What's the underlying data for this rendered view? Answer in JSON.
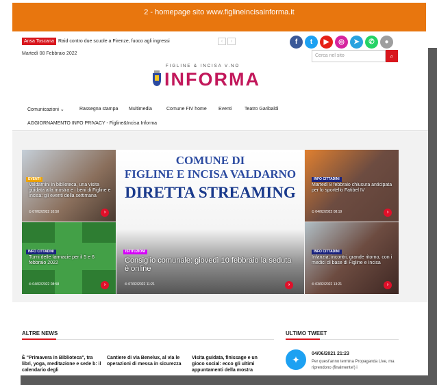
{
  "banner": {
    "caption": "2 - homepage sito www.figlineincisainforma.it"
  },
  "topbar": {
    "ticker_tag": "Ansa Toscana",
    "ticker_text": "Raid contro due scuole a Firenze, fuoco agli ingressi",
    "date": "Martedì 08 Febbraio 2022",
    "search_placeholder": "Cerca nel sito",
    "social": [
      {
        "name": "facebook-icon",
        "glyph": "f",
        "color": "#3b5998"
      },
      {
        "name": "twitter-icon",
        "glyph": "t",
        "color": "#1da1f2"
      },
      {
        "name": "youtube-icon",
        "glyph": "▶",
        "color": "#e62117"
      },
      {
        "name": "instagram-icon",
        "glyph": "◎",
        "color": "#d6249f"
      },
      {
        "name": "telegram-icon",
        "glyph": "➤",
        "color": "#2aa3df"
      },
      {
        "name": "whatsapp-icon",
        "glyph": "✆",
        "color": "#25d366"
      },
      {
        "name": "app-icon",
        "glyph": "●",
        "color": "#9e9e9e"
      }
    ]
  },
  "logo": {
    "top": "FIGLINE & INCISA V.NO",
    "main": "INFORMA",
    "color": "#c2185b"
  },
  "nav": {
    "items": [
      "Comunicazioni ⌄",
      "Rassegna stampa",
      "Multimedia",
      "Comune FIV home",
      "Eventi",
      "Teatro Garibaldi"
    ],
    "privacy": "AGGIORNAMENTO INFO PRIVACY - Figline&Incisa Informa"
  },
  "hero": {
    "line1": "COMUNE DI",
    "line2": "FIGLINE E INCISA VALDARNO",
    "line3": "DIRETTA STREAMING",
    "category": "ISTITUZIONI",
    "title": "Consiglio comunale: giovedì 10 febbraio la seduta è online",
    "date": "⏲ 07/02/2022 11:21"
  },
  "tiles": [
    {
      "category": "EVENTI",
      "cat_color": "#f0a500",
      "title": "Valdarnini in biblioteca, una visita guidata alla mostra e i beni di Figline e Incisa: gli eventi della settimana",
      "date": "⏲ 07/02/2022 10:50"
    },
    {
      "category": "INFO CITTADINI",
      "cat_color": "#1a237e",
      "title": "Martedì 8 febbraio chiusura anticipata per lo sportello Fatibel IV",
      "date": "⏲ 04/02/2022 08:19"
    },
    {
      "category": "INFO CITTADINI",
      "cat_color": "#1a237e",
      "title": "Turni delle farmacie per il 5 e 6 febbraio 2022",
      "date": "⏲ 04/02/2022 08:58"
    },
    {
      "category": "INFO CITTADINI",
      "cat_color": "#1a237e",
      "title": "Infanzia, incontri, grande ritorno, con i medici di base di Figline e Incisa",
      "date": "⏲ 03/02/2022 13:21"
    }
  ],
  "sections": {
    "altre_news_title": "ALTRE NEWS",
    "ultimo_tweet_title": "ULTIMO TWEET",
    "news": [
      "È \"Primavera in Biblioteca\", tra libri, yoga, meditazione e sede b: il calendario degli",
      "Cantiere di via Benelux, al via le operazioni di messa in sicurezza",
      "Visita guidata, finissage e un gioco social: ecco gli ultimi appuntamenti della mostra"
    ],
    "tweet_date": "04/06/2021 21:23",
    "tweet_text": "Per quest'anno termina Propaganda Live, ma riprendono (finalmente!) i"
  }
}
